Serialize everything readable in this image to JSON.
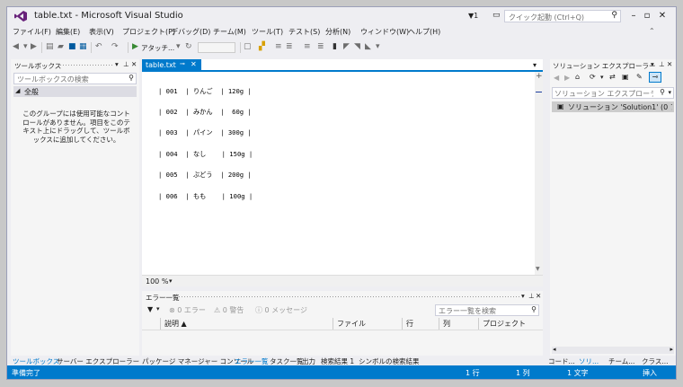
{
  "window": {
    "title": "table.txt - Microsoft Visual Studio",
    "notification_count": "1",
    "quick_launch_placeholder": "クイック起動 (Ctrl+Q)"
  },
  "menu": [
    "ファイル(F)",
    "編集(E)",
    "表示(V)",
    "プロジェクト(P)",
    "デバッグ(D)",
    "チーム(M)",
    "ツール(T)",
    "テスト(S)",
    "分析(N)",
    "ウィンドウ(W)",
    "ヘルプ(H)"
  ],
  "toolbar": {
    "attach_label": "アタッチ..."
  },
  "toolbox": {
    "title": "ツールボックス",
    "search_placeholder": "ツールボックスの検索",
    "group": "全般",
    "empty_message": "このグループには使用可能なコントロールがありません。項目をこのテキスト上にドラッグして、ツールボックスに追加してください。"
  },
  "editor": {
    "tab_label": "table.txt",
    "zoom": "100 %",
    "lines": [
      "| 001  | りんご  | 120g |",
      "| 002  | みかん  |  60g |",
      "| 003  | パイン  | 300g |",
      "| 004  | なし    | 150g |",
      "| 005  | ぶどう  | 200g |",
      "| 006  | もも    | 100g |"
    ]
  },
  "error_list": {
    "title": "エラー一覧",
    "errors_label": "0 エラー",
    "warnings_label": "0 警告",
    "messages_label": "0 メッセージ",
    "search_placeholder": "エラー一覧を検索",
    "columns": [
      "説明",
      "ファイル",
      "行",
      "列",
      "プロジェクト"
    ]
  },
  "solution_explorer": {
    "title": "ソリューション エクスプローラー",
    "search_placeholder": "ソリューション エクスプローラー の検索 (",
    "item": "ソリューション 'Solution1' (0 プロジェクト"
  },
  "bottom_tabs": {
    "left": [
      "ツールボックス",
      "サーバー エクスプローラー"
    ],
    "middle": [
      "パッケージ マネージャー コンソール",
      "エラー一覧",
      "タスク一覧",
      "出力",
      "検索結果 1",
      "シンボルの検索結果"
    ],
    "right": [
      "コード...",
      "ソリ...",
      "チーム...",
      "クラス..."
    ]
  },
  "status": {
    "ready": "準備完了",
    "line": "1 行",
    "column": "1 列",
    "char": "1 文字",
    "mode": "挿入"
  },
  "colors": {
    "accent": "#007acc",
    "chrome": "#eeeef2",
    "vs_purple": "#68217a"
  }
}
